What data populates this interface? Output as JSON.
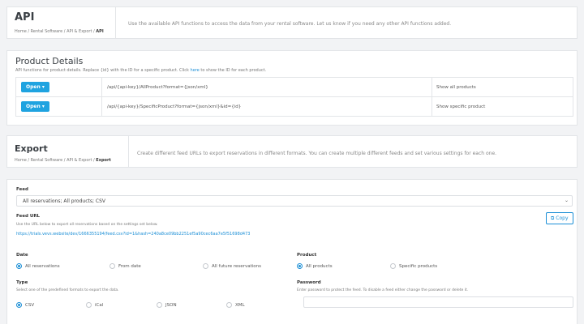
{
  "header_api": {
    "title": "API",
    "breadcrumbs": [
      "Home",
      "Rental Software",
      "API & Export",
      "API"
    ],
    "description": "Use the available API functions to access the data from your rental software. Let us know if you need any other API functions added."
  },
  "product_details": {
    "title": "Product Details",
    "subtitle_pre": "API functions for product details. Replace {id} with the ID for a specific product. Click ",
    "subtitle_link": "here",
    "subtitle_post": " to show the ID for each product.",
    "rows": [
      {
        "button": "Open ▾",
        "endpoint": "/api/{api-key}/AllProduct?format={json/xml}",
        "description": "Show all products"
      },
      {
        "button": "Open ▾",
        "endpoint": "/api/{api-key}/SpecificProduct?format={json/xml}&id={id}",
        "description": "Show specific product"
      }
    ]
  },
  "header_export": {
    "title": "Export",
    "breadcrumbs": [
      "Home",
      "Rental Software",
      "API & Export",
      "Export"
    ],
    "description": "Create different feed URLs to export reservations in different formats. You can create multiple different feeds and set various settings for each one."
  },
  "form": {
    "feed_label": "Feed",
    "feed_value": "All reservations; All products; CSV",
    "feed_url_label": "Feed URL",
    "feed_url_help": "Use the URL below to export all reservations based on the settings set below.",
    "feed_url": "https://trials.vevs.website/dev/1666355194/feed.csv?id=1&hash=240a8ce09bb2251ef5a90cec6aa7e5f51698d473",
    "copy_label": "Copy",
    "date_label": "Date",
    "date_options": [
      "All reservations",
      "From date",
      "All future reservations"
    ],
    "product_label": "Product",
    "product_options": [
      "All products",
      "Specific products"
    ],
    "type_label": "Type",
    "type_help": "Select one of the predefined formats to export the data.",
    "type_options": [
      "CSV",
      "iCal",
      "JSON",
      "XML"
    ],
    "password_label": "Password",
    "password_help": "Enter password to protect the feed. To disable a feed either change the password or delete it.",
    "password_value": ""
  },
  "colors": {
    "accent": "#1fa3e0",
    "link": "#1c8fd6"
  }
}
